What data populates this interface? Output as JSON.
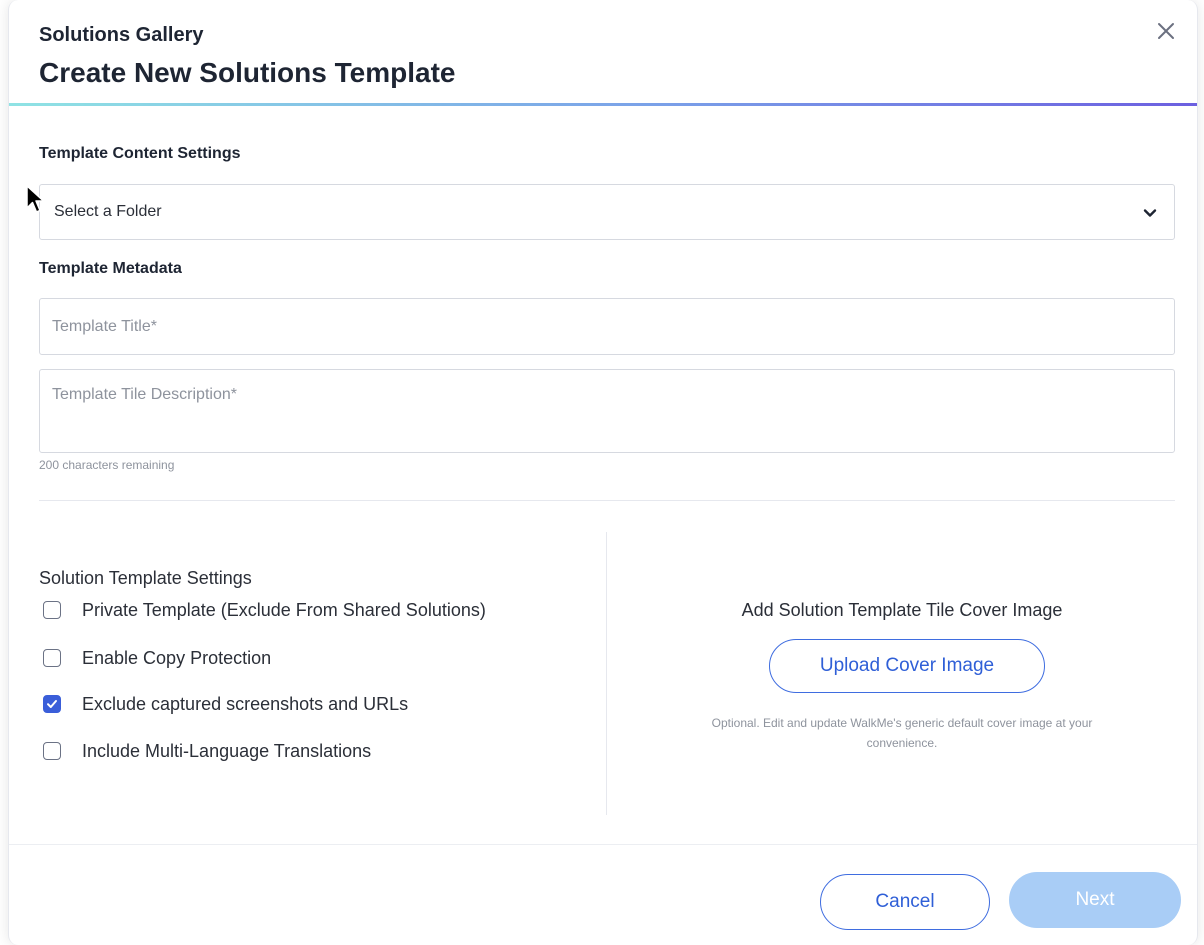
{
  "modal": {
    "subtitle": "Solutions Gallery",
    "title": "Create New Solutions Template",
    "close_icon": "close-icon"
  },
  "content_settings": {
    "label": "Template Content Settings",
    "folder_select": {
      "value": "Select a Folder",
      "icon": "chevron-down-icon"
    }
  },
  "metadata": {
    "label": "Template Metadata",
    "title_placeholder": "Template Title*",
    "description_placeholder": "Template Tile Description*",
    "char_counter": "200 characters remaining"
  },
  "solution_settings": {
    "label": "Solution Template Settings",
    "options": [
      {
        "label": "Private Template (Exclude From Shared Solutions)",
        "checked": false
      },
      {
        "label": "Enable Copy Protection",
        "checked": false
      },
      {
        "label": "Exclude captured screenshots and URLs",
        "checked": true
      },
      {
        "label": "Include Multi-Language Translations",
        "checked": false
      }
    ]
  },
  "cover_image": {
    "title": "Add Solution Template Tile Cover Image",
    "upload_label": "Upload Cover Image",
    "help_line1": "Optional. Edit and update WalkMe's generic default cover image at your",
    "help_line2": "convenience."
  },
  "footer": {
    "cancel_label": "Cancel",
    "next_label": "Next",
    "next_enabled": false
  },
  "colors": {
    "accent": "#3f6de0",
    "checkbox_checked": "#3a5ed9",
    "next_disabled": "#a9cdf6",
    "header_gradient_start": "#8fe3e4",
    "header_gradient_end": "#6c5fe0"
  }
}
